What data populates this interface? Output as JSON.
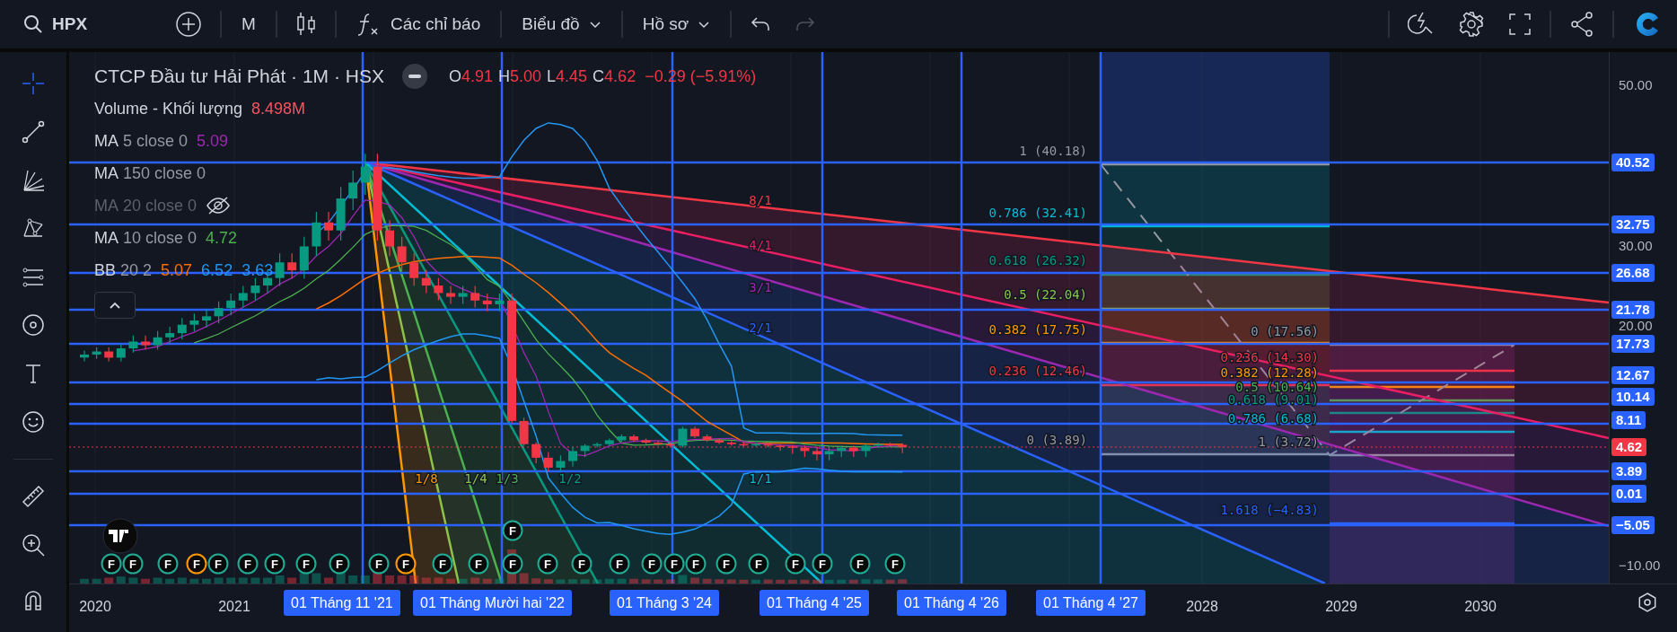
{
  "toolbar": {
    "symbol": "HPX",
    "interval": "M",
    "indicators_label": "Các chỉ báo",
    "chart_menu": "Biểu đồ",
    "profile_menu": "Hồ sơ",
    "redo_disabled": true
  },
  "legend": {
    "title": "CTCP Đầu tư Hải Phát · 1M · HSX",
    "ohlc": [
      {
        "label": "O",
        "value": "4.91"
      },
      {
        "label": "H",
        "value": "5.00"
      },
      {
        "label": "L",
        "value": "4.45"
      },
      {
        "label": "C",
        "value": "4.62"
      }
    ],
    "change": "−0.29 (−5.91%)",
    "indicators": [
      {
        "name": "Volume - Khối lượng",
        "hidden": false,
        "values": [
          {
            "text": "8.498M",
            "color": "#f7525f"
          }
        ]
      },
      {
        "name": "MA",
        "params": "5 close 0",
        "hidden": false,
        "values": [
          {
            "text": "5.09",
            "color": "#9c27b0"
          }
        ]
      },
      {
        "name": "MA",
        "params": "150 close 0",
        "hidden": false
      },
      {
        "name": "MA",
        "params": "20 close 0",
        "hidden": true
      },
      {
        "name": "MA",
        "params": "10 close 0",
        "hidden": false,
        "values": [
          {
            "text": "4.72",
            "color": "#4caf50"
          }
        ]
      },
      {
        "name": "BB",
        "params": "20 2",
        "hidden": false,
        "values": [
          {
            "text": "5.07",
            "color": "#ff6d00"
          },
          {
            "text": "6.52",
            "color": "#2196f3"
          },
          {
            "text": "3.63",
            "color": "#2196f3"
          }
        ]
      }
    ]
  },
  "gann_levels": [
    {
      "text": "8/1",
      "color": "#f23645"
    },
    {
      "text": "4/1",
      "color": "#e91e63"
    },
    {
      "text": "3/1",
      "color": "#9c27b0"
    },
    {
      "text": "2/1",
      "color": "#2962ff"
    },
    {
      "text": "1/8",
      "color": "#ff9800"
    },
    {
      "text": "1/4",
      "color": "#8bc34a"
    },
    {
      "text": "1/3",
      "color": "#4caf50"
    },
    {
      "text": "1/2",
      "color": "#089981"
    },
    {
      "text": "1/1",
      "color": "#00bcd4"
    }
  ],
  "fib_retracement": [
    {
      "text": "1 (40.18)",
      "color": "#9598a1"
    },
    {
      "text": "0.786 (32.41)",
      "color": "#00bcd4"
    },
    {
      "text": "0.618 (26.32)",
      "color": "#089981"
    },
    {
      "text": "0.5 (22.04)",
      "color": "#8bc34a"
    },
    {
      "text": "0.382 (17.75)",
      "color": "#ff9800"
    },
    {
      "text": "0.236 (12.46)",
      "color": "#f23645"
    },
    {
      "text": "0 (3.89)",
      "color": "#9598a1"
    }
  ],
  "fib_extension": [
    {
      "text": "0 (17.56)",
      "color": "#9598a1"
    },
    {
      "text": "0.236 (14.30)",
      "color": "#f23645"
    },
    {
      "text": "0.382 (12.28)",
      "color": "#ff9800"
    },
    {
      "text": "0.5 (10.64)",
      "color": "#4caf50"
    },
    {
      "text": "0.618 (9.01)",
      "color": "#089981"
    },
    {
      "text": "0.786 (6.68)",
      "color": "#00bcd4"
    },
    {
      "text": "1 (3.72)",
      "color": "#9598a1"
    },
    {
      "text": "1.618 (−4.83)",
      "color": "#2962ff"
    }
  ],
  "price_axis": {
    "ticks": [
      "50.00",
      "30.00",
      "20.00",
      "−10.00"
    ],
    "labels": [
      {
        "text": "40.52",
        "color": "#2962ff"
      },
      {
        "text": "32.75",
        "color": "#2962ff"
      },
      {
        "text": "26.68",
        "color": "#2962ff"
      },
      {
        "text": "21.78",
        "color": "#2962ff"
      },
      {
        "text": "17.73",
        "color": "#2962ff"
      },
      {
        "text": "12.67",
        "color": "#2962ff"
      },
      {
        "text": "10.14",
        "color": "#2962ff"
      },
      {
        "text": "8.11",
        "color": "#2962ff"
      },
      {
        "text": "4.62",
        "color": "#f23645"
      },
      {
        "text": "3.89",
        "color": "#2962ff"
      },
      {
        "text": "0.01",
        "color": "#2962ff"
      },
      {
        "text": "−5.05",
        "color": "#2962ff"
      }
    ]
  },
  "events": [
    {
      "text": "F",
      "color": "#22ab94"
    },
    {
      "text": "F",
      "color": "#22ab94"
    },
    {
      "text": "F",
      "color": "#22ab94"
    },
    {
      "text": "F",
      "color": "#22ab94"
    },
    {
      "text": "F",
      "color": "#ff9800"
    },
    {
      "text": "F",
      "color": "#22ab94"
    },
    {
      "text": "F",
      "color": "#22ab94"
    },
    {
      "text": "F",
      "color": "#22ab94"
    },
    {
      "text": "F",
      "color": "#22ab94"
    },
    {
      "text": "F",
      "color": "#22ab94"
    },
    {
      "text": "F",
      "color": "#22ab94"
    },
    {
      "text": "F",
      "color": "#ff9800"
    },
    {
      "text": "F",
      "color": "#22ab94"
    },
    {
      "text": "F",
      "color": "#22ab94"
    },
    {
      "text": "F",
      "color": "#22ab94"
    },
    {
      "text": "F",
      "color": "#22ab94"
    },
    {
      "text": "F",
      "color": "#22ab94"
    },
    {
      "text": "F",
      "color": "#22ab94"
    },
    {
      "text": "F",
      "color": "#22ab94"
    },
    {
      "text": "F",
      "color": "#22ab94"
    },
    {
      "text": "F",
      "color": "#22ab94"
    },
    {
      "text": "F",
      "color": "#22ab94"
    },
    {
      "text": "F",
      "color": "#22ab94"
    },
    {
      "text": "F",
      "color": "#22ab94"
    },
    {
      "text": "F",
      "color": "#22ab94"
    },
    {
      "text": "F",
      "color": "#22ab94"
    },
    {
      "text": "F",
      "color": "#22ab94"
    }
  ],
  "time_axis": {
    "ticks": [
      "2020",
      "2021",
      "2028",
      "2029",
      "2030"
    ],
    "markers": [
      "01 Tháng 11 '21",
      "01 Tháng Mười hai '22",
      "01 Tháng 3 '24",
      "01 Tháng 4 '25",
      "01 Tháng 4 '26",
      "01 Tháng 4 '27"
    ]
  }
}
